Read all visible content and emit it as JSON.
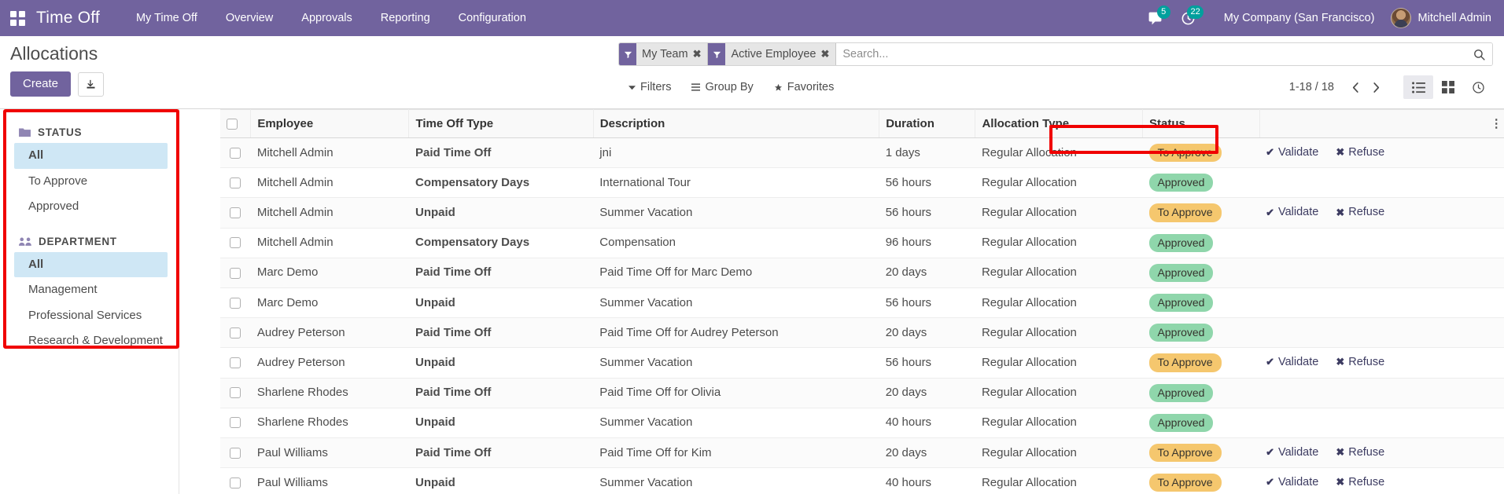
{
  "navbar": {
    "apps_icon": "apps-grid-icon",
    "brand": "Time Off",
    "menus": [
      {
        "label": "My Time Off"
      },
      {
        "label": "Overview"
      },
      {
        "label": "Approvals"
      },
      {
        "label": "Reporting"
      },
      {
        "label": "Configuration"
      }
    ],
    "messaging": {
      "icon": "messages-icon",
      "count": "5"
    },
    "activities": {
      "icon": "clock-activity-icon",
      "count": "22"
    },
    "company": "My Company (San Francisco)",
    "user": "Mitchell Admin",
    "avatar_icon": "user-avatar"
  },
  "control_panel": {
    "title": "Allocations",
    "create_label": "Create",
    "import_icon": "import-download-icon",
    "search": {
      "placeholder": "Search...",
      "value": "",
      "magnifier_icon": "search-icon",
      "facets": [
        {
          "icon": "filter-funnel-icon",
          "label": "My Team",
          "remove_icon": "remove-facet-icon"
        },
        {
          "icon": "filter-funnel-icon",
          "label": "Active Employee",
          "remove_icon": "remove-facet-icon"
        }
      ]
    },
    "filters_label": "Filters",
    "filters_icon": "caret-down-icon",
    "groupby_label": "Group By",
    "groupby_icon": "bars-icon",
    "favorites_label": "Favorites",
    "favorites_icon": "star-icon",
    "pager": "1-18 / 18",
    "prev_icon": "chevron-left-icon",
    "next_icon": "chevron-right-icon",
    "views": [
      {
        "icon": "list-view-icon",
        "active": true
      },
      {
        "icon": "kanban-view-icon",
        "active": false
      },
      {
        "icon": "activity-view-icon",
        "active": false
      }
    ]
  },
  "sidebar": {
    "sections": [
      {
        "title": "STATUS",
        "icon": "folder-icon",
        "items": [
          {
            "label": "All",
            "selected": true
          },
          {
            "label": "To Approve",
            "selected": false
          },
          {
            "label": "Approved",
            "selected": false
          }
        ]
      },
      {
        "title": "DEPARTMENT",
        "icon": "users-group-icon",
        "items": [
          {
            "label": "All",
            "selected": true
          },
          {
            "label": "Management",
            "selected": false
          },
          {
            "label": "Professional Services",
            "selected": false
          },
          {
            "label": "Research & Development",
            "selected": false
          }
        ]
      }
    ]
  },
  "table": {
    "select_all_icon": "checkbox-icon",
    "options_icon": "column-options-icon",
    "columns": [
      "Employee",
      "Time Off Type",
      "Description",
      "Duration",
      "Allocation Type",
      "Status",
      ""
    ],
    "validate_label": "Validate",
    "validate_icon": "check-icon",
    "refuse_label": "Refuse",
    "refuse_icon": "times-icon",
    "rows": [
      {
        "employee": "Mitchell Admin",
        "type": "Paid Time Off",
        "description": "jni",
        "duration": "1 days",
        "allocation_type": "Regular Allocation",
        "status": "To Approve",
        "status_kind": "warn",
        "actions": true
      },
      {
        "employee": "Mitchell Admin",
        "type": "Compensatory Days",
        "description": "International Tour",
        "duration": "56 hours",
        "allocation_type": "Regular Allocation",
        "status": "Approved",
        "status_kind": "ok",
        "actions": false
      },
      {
        "employee": "Mitchell Admin",
        "type": "Unpaid",
        "description": "Summer Vacation",
        "duration": "56 hours",
        "allocation_type": "Regular Allocation",
        "status": "To Approve",
        "status_kind": "warn",
        "actions": true
      },
      {
        "employee": "Mitchell Admin",
        "type": "Compensatory Days",
        "description": "Compensation",
        "duration": "96 hours",
        "allocation_type": "Regular Allocation",
        "status": "Approved",
        "status_kind": "ok",
        "actions": false
      },
      {
        "employee": "Marc Demo",
        "type": "Paid Time Off",
        "description": "Paid Time Off for Marc Demo",
        "duration": "20 days",
        "allocation_type": "Regular Allocation",
        "status": "Approved",
        "status_kind": "ok",
        "actions": false
      },
      {
        "employee": "Marc Demo",
        "type": "Unpaid",
        "description": "Summer Vacation",
        "duration": "56 hours",
        "allocation_type": "Regular Allocation",
        "status": "Approved",
        "status_kind": "ok",
        "actions": false
      },
      {
        "employee": "Audrey Peterson",
        "type": "Paid Time Off",
        "description": "Paid Time Off for Audrey Peterson",
        "duration": "20 days",
        "allocation_type": "Regular Allocation",
        "status": "Approved",
        "status_kind": "ok",
        "actions": false
      },
      {
        "employee": "Audrey Peterson",
        "type": "Unpaid",
        "description": "Summer Vacation",
        "duration": "56 hours",
        "allocation_type": "Regular Allocation",
        "status": "To Approve",
        "status_kind": "warn",
        "actions": true
      },
      {
        "employee": "Sharlene Rhodes",
        "type": "Paid Time Off",
        "description": "Paid Time Off for Olivia",
        "duration": "20 days",
        "allocation_type": "Regular Allocation",
        "status": "Approved",
        "status_kind": "ok",
        "actions": false
      },
      {
        "employee": "Sharlene Rhodes",
        "type": "Unpaid",
        "description": "Summer Vacation",
        "duration": "40 hours",
        "allocation_type": "Regular Allocation",
        "status": "Approved",
        "status_kind": "ok",
        "actions": false
      },
      {
        "employee": "Paul Williams",
        "type": "Paid Time Off",
        "description": "Paid Time Off for Kim",
        "duration": "20 days",
        "allocation_type": "Regular Allocation",
        "status": "To Approve",
        "status_kind": "warn",
        "actions": true
      },
      {
        "employee": "Paul Williams",
        "type": "Unpaid",
        "description": "Summer Vacation",
        "duration": "40 hours",
        "allocation_type": "Regular Allocation",
        "status": "To Approve",
        "status_kind": "warn",
        "actions": true
      }
    ]
  },
  "highlights": {
    "accent_red": "#f00000",
    "brand_purple": "#71639e",
    "selected_blue": "#cfe7f5",
    "badge_warn": "#f5c76e",
    "badge_ok": "#8fd6ab"
  }
}
